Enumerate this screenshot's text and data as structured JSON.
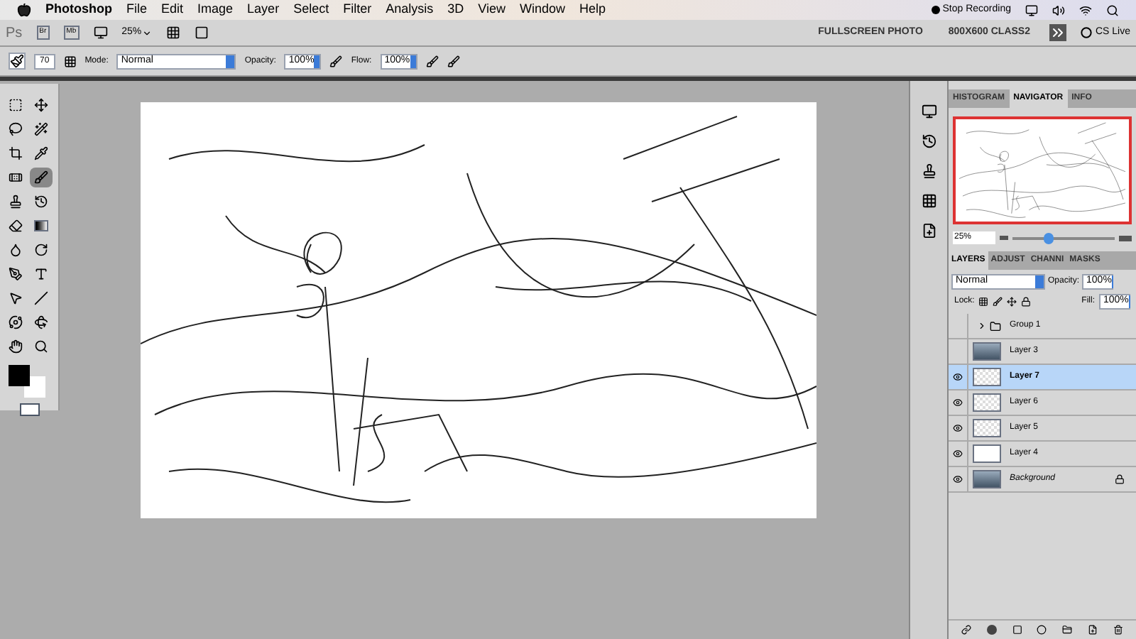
{
  "menu_bar": {
    "app_name": "Photoshop",
    "items": [
      "File",
      "Edit",
      "Image",
      "Layer",
      "Select",
      "Filter",
      "Analysis",
      "3D",
      "View",
      "Window",
      "Help"
    ],
    "recording": "Stop Recording"
  },
  "app_bar": {
    "logo": "Ps",
    "bridge": "Br",
    "mini_bridge": "Mb",
    "zoom": "25%",
    "workspaces": [
      "FULLSCREEN PHOTO",
      "800X600 CLASS2"
    ],
    "cs_live": "CS Live"
  },
  "options_bar": {
    "brush_size": "70",
    "mode_label": "Mode:",
    "mode": "Normal",
    "opacity_label": "Opacity:",
    "opacity": "100%",
    "flow_label": "Flow:",
    "flow": "100%"
  },
  "tools": [
    {
      "kind": "marquee",
      "selected": false
    },
    {
      "kind": "move",
      "selected": false
    },
    {
      "kind": "lasso",
      "selected": false
    },
    {
      "kind": "wand",
      "selected": false
    },
    {
      "kind": "crop",
      "selected": false
    },
    {
      "kind": "eyedropper",
      "selected": false
    },
    {
      "kind": "healing",
      "selected": false
    },
    {
      "kind": "brush",
      "selected": true
    },
    {
      "kind": "stamp",
      "selected": false
    },
    {
      "kind": "history",
      "selected": false
    },
    {
      "kind": "eraser",
      "selected": false
    },
    {
      "kind": "gradient",
      "selected": false
    },
    {
      "kind": "dodge",
      "selected": false
    },
    {
      "kind": "rotate",
      "selected": false
    },
    {
      "kind": "pen",
      "selected": false
    },
    {
      "kind": "text",
      "selected": false
    },
    {
      "kind": "select",
      "selected": false
    },
    {
      "kind": "line",
      "selected": false
    },
    {
      "kind": "orbit",
      "selected": false
    },
    {
      "kind": "orbit2",
      "selected": false
    },
    {
      "kind": "hand",
      "selected": false
    },
    {
      "kind": "zoom",
      "selected": false
    }
  ],
  "navigator": {
    "tabs": [
      {
        "label": "HISTOGRAM",
        "selected": false
      },
      {
        "label": "NAVIGATOR",
        "selected": true
      },
      {
        "label": "INFO",
        "selected": false
      }
    ],
    "zoom": "25%",
    "level": 0.35
  },
  "layers_panel": {
    "tabs": [
      {
        "label": "LAYERS",
        "selected": true
      },
      {
        "label": "ADJUST",
        "selected": false
      },
      {
        "label": "CHANNI",
        "selected": false
      },
      {
        "label": "MASKS",
        "selected": false
      }
    ],
    "blend": "Normal",
    "opacity_label": "Opacity:",
    "opacity": "100%",
    "lock_label": "Lock:",
    "fill_label": "Fill:",
    "fill": "100%",
    "layers": [
      {
        "name": "Group 1",
        "kind": "group",
        "visible": false,
        "selected": false,
        "locked": false
      },
      {
        "name": "Layer 3",
        "kind": "photo",
        "visible": false,
        "selected": false,
        "locked": false
      },
      {
        "name": "Layer 7",
        "kind": "transparent",
        "visible": true,
        "selected": true,
        "locked": false
      },
      {
        "name": "Layer 6",
        "kind": "transparent",
        "visible": true,
        "selected": false,
        "locked": false
      },
      {
        "name": "Layer 5",
        "kind": "transparent",
        "visible": true,
        "selected": false,
        "locked": false
      },
      {
        "name": "Layer 4",
        "kind": "white",
        "visible": true,
        "selected": false,
        "locked": false
      },
      {
        "name": "Background",
        "kind": "photo",
        "visible": true,
        "selected": false,
        "locked": true
      }
    ]
  }
}
